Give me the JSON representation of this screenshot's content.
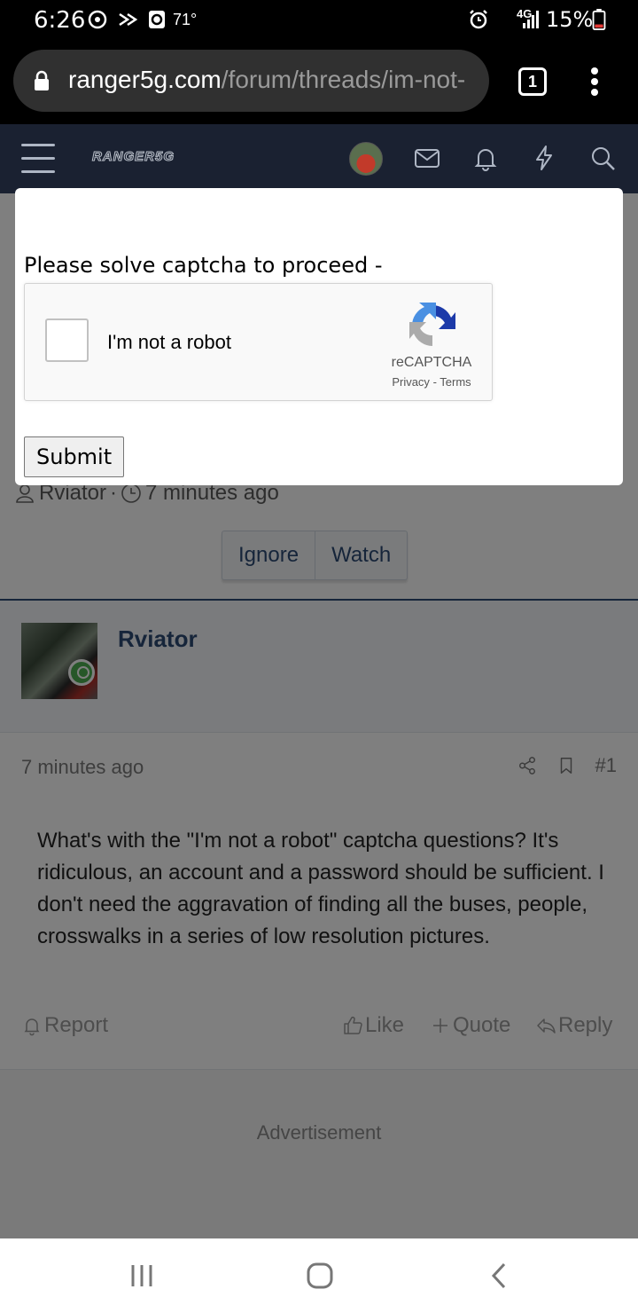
{
  "status_bar": {
    "time": "6:26",
    "temperature": "71°",
    "network": "4G",
    "battery": "15%",
    "icons": [
      "sync-icon",
      "forward-icon",
      "app-icon",
      "alarm-icon",
      "signal-icon",
      "battery-icon"
    ]
  },
  "browser": {
    "url_domain": "ranger5g.com",
    "url_path": "/forum/threads/im-not-",
    "tab_count": "1"
  },
  "site_header": {
    "logo_text": "RANGER5G"
  },
  "captcha_modal": {
    "prompt": "Please solve captcha to proceed -",
    "checkbox_label": "I'm not a robot",
    "brand": "reCAPTCHA",
    "privacy_link": "Privacy",
    "link_separator": "-",
    "terms_link": "Terms",
    "submit_label": "Submit"
  },
  "thread": {
    "author": "Rviator",
    "separator": "·",
    "time": "7 minutes ago",
    "ignore_label": "Ignore",
    "watch_label": "Watch"
  },
  "post": {
    "author": "Rviator",
    "time": "7 minutes ago",
    "post_number": "#1",
    "body": "What's with the \"I'm not a robot\" captcha questions? It's ridiculous, an account and a password should be sufficient. I don't need the aggravation of finding all the buses, people, crosswalks in a series of low resolution pictures.",
    "actions": {
      "report": "Report",
      "like": "Like",
      "quote": "Quote",
      "reply": "Reply"
    }
  },
  "advertisement_label": "Advertisement",
  "colors": {
    "header_bg": "#1a2131",
    "accent": "#2c4a74",
    "online": "#4caf50"
  }
}
